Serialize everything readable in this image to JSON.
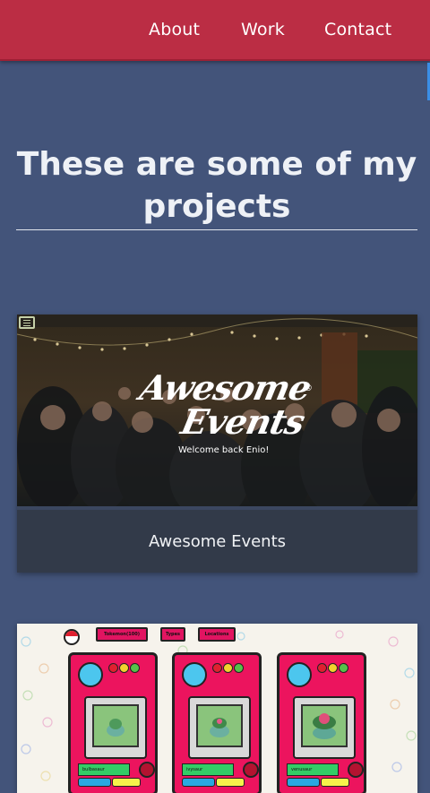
{
  "nav": {
    "links": [
      "About",
      "Work",
      "Contact"
    ]
  },
  "projects": {
    "heading": "These are some of my projects",
    "cards": [
      {
        "title": "Awesome Events",
        "logo_line1": "Awesome",
        "logo_line2": "Events",
        "welcome": "Welcome back Enio!"
      },
      {
        "tabs": [
          "Tokemon(100)",
          "Types",
          "Locations"
        ],
        "dex_names": [
          "bulbasaur",
          "ivysaur",
          "venusaur"
        ]
      }
    ]
  },
  "colors": {
    "navbar": "#bb2d44",
    "page_bg": "#43547a",
    "caption_bg": "#323a49",
    "dex_pink": "#ec145e"
  },
  "icons": {
    "menu": "hamburger-icon",
    "pokeball": "pokeball-icon"
  }
}
